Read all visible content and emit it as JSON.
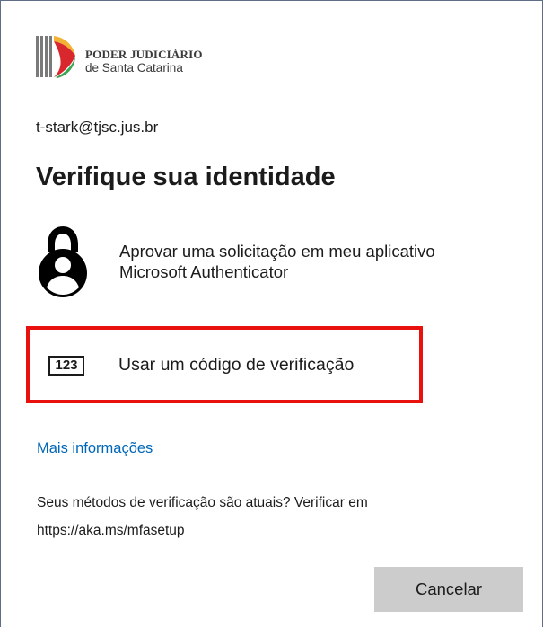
{
  "logo": {
    "line1": "PODER JUDICIÁRIO",
    "line2": "de Santa Catarina",
    "colors": {
      "yellow": "#f2b233",
      "red": "#d9272e",
      "green": "#3aa655",
      "gray": "#7a7a7a"
    }
  },
  "account": {
    "email": "t-stark@tjsc.jus.br"
  },
  "title": "Verifique sua identidade",
  "options": [
    {
      "icon": "lock-person-icon",
      "label": "Aprovar uma solicitação em meu aplicativo Microsoft Authenticator"
    },
    {
      "icon": "code-123-icon",
      "badge": "123",
      "label": "Usar um código de verificação",
      "highlight_color": "#e8110e"
    }
  ],
  "more_info": {
    "label": "Mais informações",
    "color": "#0067b8"
  },
  "info_text": "Seus métodos de verificação são atuais? Verificar em https://aka.ms/mfasetup",
  "cancel_button": {
    "label": "Cancelar"
  }
}
